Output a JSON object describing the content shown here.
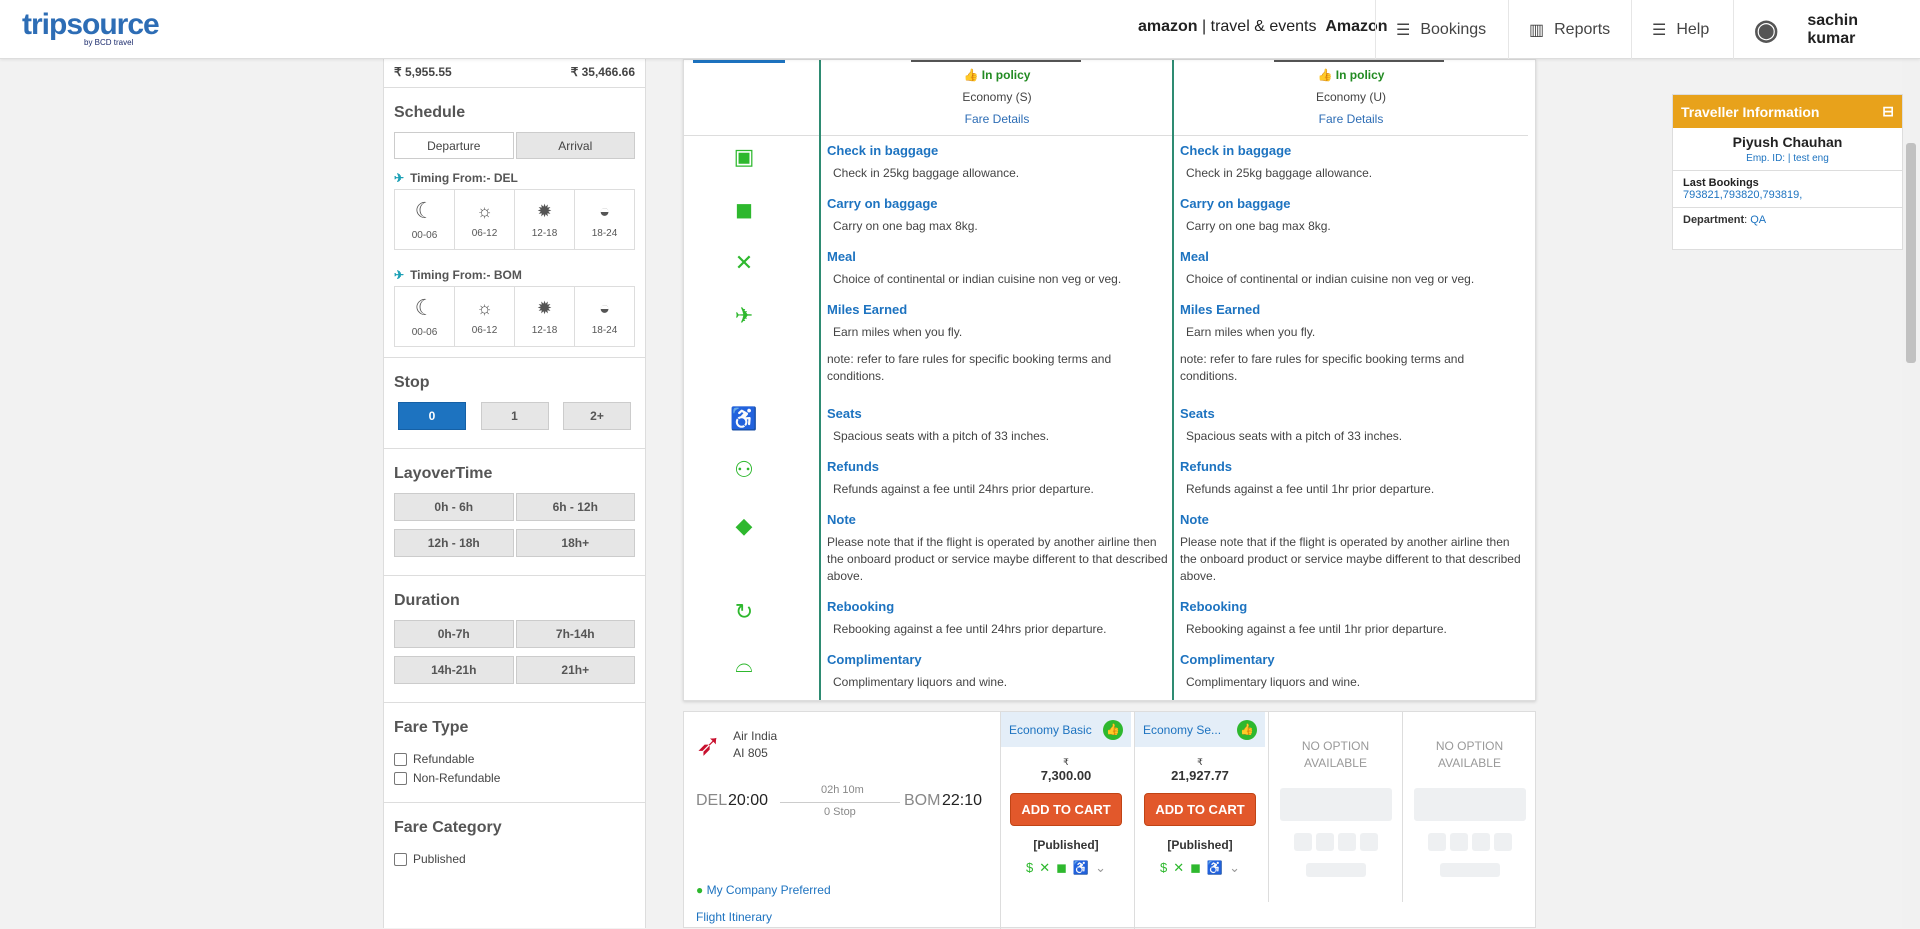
{
  "header": {
    "logo": "tripsource",
    "logo_sub": "by BCD travel",
    "brand_a": "amazon",
    "brand_b": "travel & events",
    "brand_c": "Amazon",
    "nav": [
      {
        "label": "Bookings",
        "icon": "menu-icon"
      },
      {
        "label": "Reports",
        "icon": "bar-chart-icon"
      },
      {
        "label": "Help",
        "icon": "menu-icon"
      }
    ],
    "user": "sachin kumar"
  },
  "sidebar": {
    "price_min": "₹ 5,955.55",
    "price_max": "₹ 35,466.66",
    "schedule": {
      "title": "Schedule",
      "tabs": [
        "Departure",
        "Arrival"
      ],
      "from": [
        {
          "label": "Timing From:- DEL"
        },
        {
          "label": "Timing From:- BOM"
        }
      ],
      "slots": [
        "00-06",
        "06-12",
        "12-18",
        "18-24"
      ]
    },
    "stop": {
      "title": "Stop",
      "options": [
        "0",
        "1",
        "2+"
      ]
    },
    "layover": {
      "title": "LayoverTime",
      "options": [
        "0h - 6h",
        "6h - 12h",
        "12h - 18h",
        "18h+"
      ]
    },
    "duration": {
      "title": "Duration",
      "options": [
        "0h-7h",
        "7h-14h",
        "14h-21h",
        "21h+"
      ]
    },
    "fare_type": {
      "title": "Fare Type",
      "options": [
        "Refundable",
        "Non-Refundable"
      ]
    },
    "fare_category": {
      "title": "Fare Category",
      "options": [
        "Published"
      ]
    }
  },
  "compare": {
    "columns": [
      {
        "policy": "In policy",
        "class": "Economy (S)",
        "fare_details": "Fare Details",
        "features": [
          {
            "t": "Check in baggage",
            "d": "Check in 25kg baggage allowance."
          },
          {
            "t": "Carry on baggage",
            "d": "Carry on one bag max 8kg."
          },
          {
            "t": "Meal",
            "d": "Choice of continental or indian cuisine non veg or veg."
          },
          {
            "t": "Miles Earned",
            "d": "Earn miles when you fly.",
            "n": "note: refer to fare rules for specific booking terms and conditions."
          },
          {
            "t": "Seats",
            "d": "Spacious seats with a pitch of 33 inches."
          },
          {
            "t": "Refunds",
            "d": "Refunds against a fee until 24hrs prior departure."
          },
          {
            "t": "Note",
            "d": "Please note that if the flight is operated by another airline then the onboard product or service maybe different to that described above."
          },
          {
            "t": "Rebooking",
            "d": "Rebooking against a fee until 24hrs prior departure."
          },
          {
            "t": "Complimentary",
            "d": "Complimentary liquors and wine."
          }
        ]
      },
      {
        "policy": "In policy",
        "class": "Economy (U)",
        "fare_details": "Fare Details",
        "features": [
          {
            "t": "Check in baggage",
            "d": "Check in 25kg baggage allowance."
          },
          {
            "t": "Carry on baggage",
            "d": "Carry on one bag max 8kg."
          },
          {
            "t": "Meal",
            "d": "Choice of continental or indian cuisine non veg or veg."
          },
          {
            "t": "Miles Earned",
            "d": "Earn miles when you fly.",
            "n": "note: refer to fare rules for specific booking terms and conditions."
          },
          {
            "t": "Seats",
            "d": "Spacious seats with a pitch of 33 inches."
          },
          {
            "t": "Refunds",
            "d": "Refunds against a fee until 1hr prior departure."
          },
          {
            "t": "Note",
            "d": "Please note that if the flight is operated by another airline then the onboard product or service maybe different to that described above."
          },
          {
            "t": "Rebooking",
            "d": "Rebooking against a fee until 1hr prior departure."
          },
          {
            "t": "Complimentary",
            "d": "Complimentary liquors and wine."
          }
        ]
      }
    ]
  },
  "flight": {
    "airline": "Air India",
    "number": "AI  805",
    "from": "DEL",
    "dep": "20:00",
    "duration": "02h 10m",
    "stops": "0 Stop",
    "to": "BOM",
    "arr": "22:10",
    "preferred": "My Company Preferred",
    "itinerary": "Flight Itinerary",
    "fares": [
      {
        "name": "Economy Basic",
        "currency": "₹",
        "price": "7,300.00",
        "cart": "ADD TO CART",
        "type": "[Published]"
      },
      {
        "name": "Economy Se...",
        "currency": "₹",
        "price": "21,927.77",
        "cart": "ADD TO CART",
        "type": "[Published]"
      }
    ],
    "na": "NO OPTION AVAILABLE"
  },
  "traveller": {
    "title": "Traveller Information",
    "name": "Piyush Chauhan",
    "emp": "Emp. ID: | test eng",
    "last_label": "Last Bookings",
    "last": "793821,793820,793819,",
    "dept_label": "Department",
    "dept": "QA"
  }
}
